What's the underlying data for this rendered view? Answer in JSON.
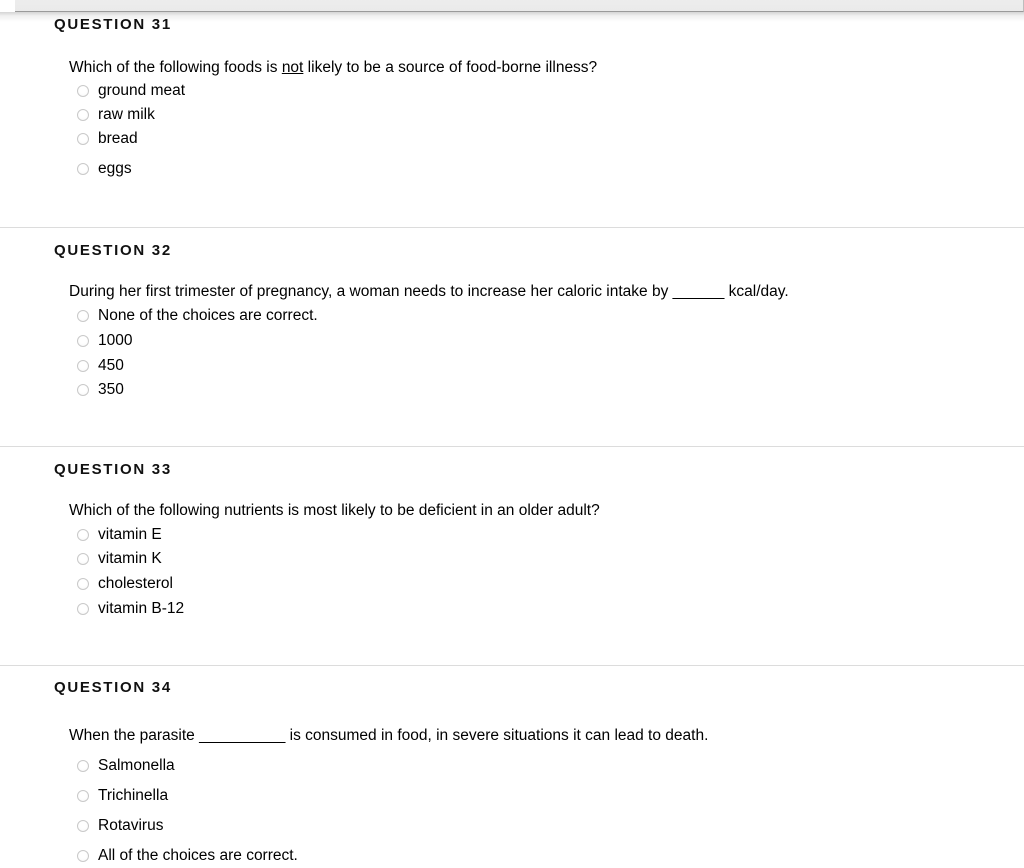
{
  "window": {
    "chrome_bar_name": "browser-window-chrome"
  },
  "quiz": {
    "questions": [
      {
        "heading": "QUESTION 31",
        "stem_before": "Which of the following foods is ",
        "stem_emphasis": "not",
        "stem_after": " likely to be a source of food-borne illness?",
        "choices": [
          "ground meat",
          "raw milk",
          "bread",
          "eggs"
        ]
      },
      {
        "heading": "QUESTION 32",
        "stem_before": "During her first trimester of pregnancy, a woman needs to increase her caloric intake by ",
        "stem_blank": "______",
        "stem_after": " kcal/day.",
        "choices": [
          "None of the choices are correct.",
          "1000",
          "450",
          "350"
        ]
      },
      {
        "heading": "QUESTION 33",
        "stem_before": "Which of the following nutrients is most likely to be deficient in an older adult?",
        "choices": [
          "vitamin E",
          "vitamin K",
          "cholesterol",
          "vitamin B-12"
        ]
      },
      {
        "heading": "QUESTION 34",
        "stem_before": "When the parasite ",
        "stem_blank": "__________",
        "stem_after": " is consumed in food, in severe situations it can lead to death.",
        "choices": [
          "Salmonella",
          "Trichinella",
          "Rotavirus",
          "All of the choices are correct."
        ]
      }
    ]
  }
}
